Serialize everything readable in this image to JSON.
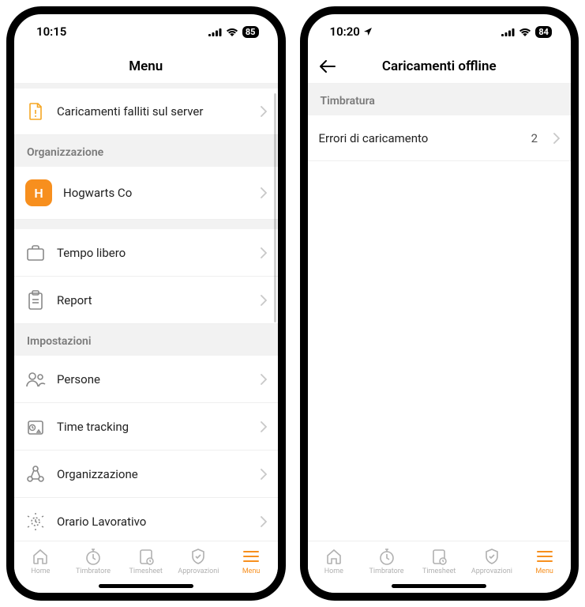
{
  "left": {
    "status": {
      "time": "10:15",
      "battery": "85"
    },
    "header": {
      "title": "Menu"
    },
    "failed": {
      "label": "Caricamenti falliti sul server"
    },
    "sections": {
      "org": {
        "title": "Organizzazione",
        "item": {
          "letter": "H",
          "label": "Hogwarts Co"
        }
      },
      "mid": {
        "items": [
          {
            "label": "Tempo libero"
          },
          {
            "label": "Report"
          }
        ]
      },
      "settings": {
        "title": "Impostazioni",
        "items": [
          {
            "label": "Persone"
          },
          {
            "label": "Time tracking"
          },
          {
            "label": "Organizzazione"
          },
          {
            "label": "Orario Lavorativo"
          }
        ]
      }
    }
  },
  "right": {
    "status": {
      "time": "10:20",
      "battery": "84"
    },
    "header": {
      "title": "Caricamenti offline"
    },
    "section": {
      "title": "Timbratura"
    },
    "row": {
      "label": "Errori di caricamento",
      "value": "2"
    }
  },
  "tabs": {
    "home": "Home",
    "timbratore": "Timbratore",
    "timesheet": "Timesheet",
    "approvazioni": "Approvazioni",
    "menu": "Menu"
  }
}
